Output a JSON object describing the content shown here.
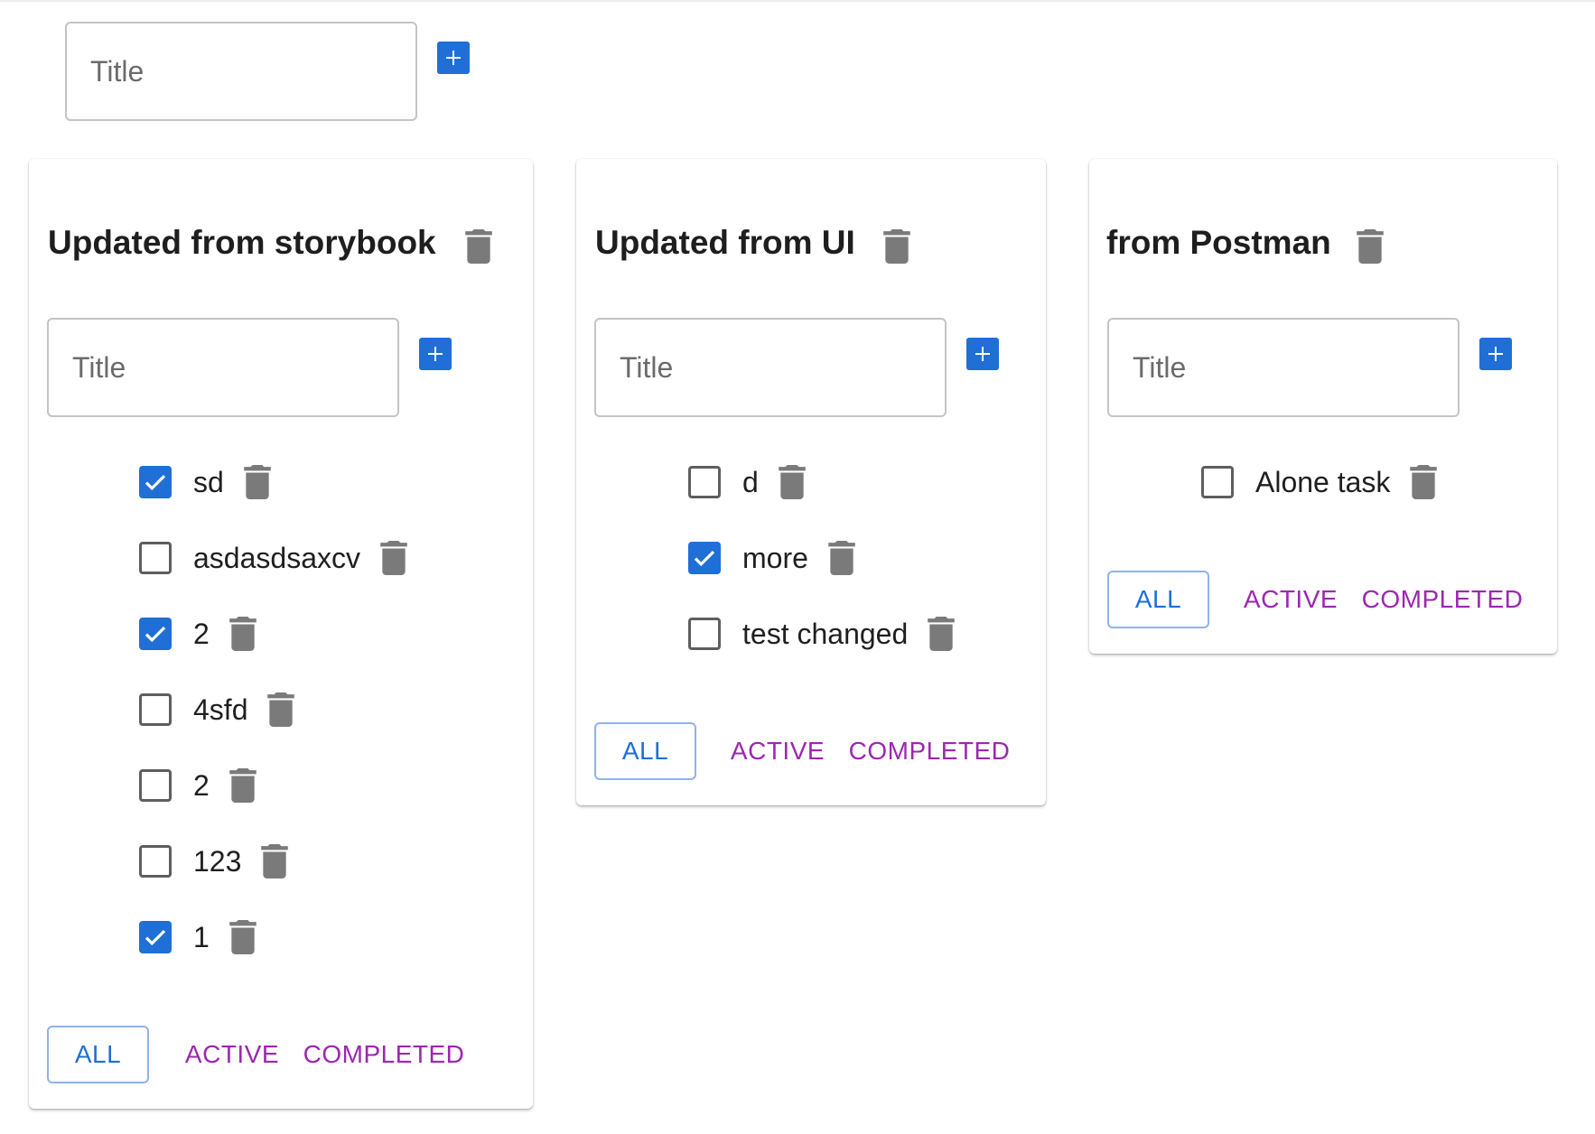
{
  "new_list": {
    "placeholder": "Title",
    "add_icon": "plus-icon"
  },
  "colors": {
    "primary": "#1f6fd6",
    "secondary": "#9c27b0",
    "icon_gray": "#7a7a7a"
  },
  "lists": [
    {
      "title": "Updated from storybook",
      "input_placeholder": "Title",
      "tasks": [
        {
          "label": "sd",
          "checked": true
        },
        {
          "label": "asdasdsaxcv",
          "checked": false
        },
        {
          "label": "2",
          "checked": true
        },
        {
          "label": "4sfd",
          "checked": false
        },
        {
          "label": "2",
          "checked": false
        },
        {
          "label": "123",
          "checked": false
        },
        {
          "label": "1",
          "checked": true
        }
      ],
      "filters": {
        "all": "ALL",
        "active": "ACTIVE",
        "completed": "COMPLETED",
        "selected": "all"
      }
    },
    {
      "title": "Updated from UI",
      "input_placeholder": "Title",
      "tasks": [
        {
          "label": "d",
          "checked": false
        },
        {
          "label": "more",
          "checked": true
        },
        {
          "label": "test changed",
          "checked": false
        }
      ],
      "filters": {
        "all": "ALL",
        "active": "ACTIVE",
        "completed": "COMPLETED",
        "selected": "all"
      }
    },
    {
      "title": "from Postman",
      "input_placeholder": "Title",
      "tasks": [
        {
          "label": "Alone task",
          "checked": false
        }
      ],
      "filters": {
        "all": "ALL",
        "active": "ACTIVE",
        "completed": "COMPLETED",
        "selected": "all"
      }
    }
  ]
}
